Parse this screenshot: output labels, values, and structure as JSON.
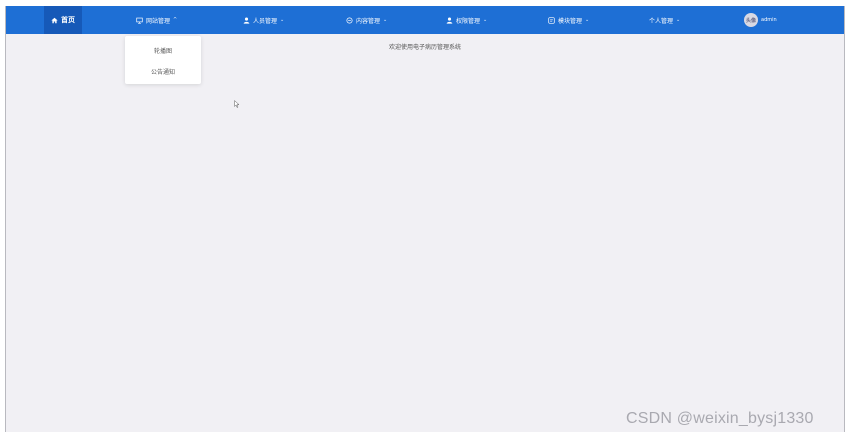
{
  "navbar": {
    "home": {
      "label": "首页",
      "icon": "home-icon"
    },
    "menus": [
      {
        "label": "网站管理",
        "icon": "monitor-icon",
        "chevron": "^",
        "expanded": true
      },
      {
        "label": "人员管理",
        "icon": "user-icon",
        "chevron": "⌄"
      },
      {
        "label": "内容管理",
        "icon": "content-icon",
        "chevron": "⌄"
      },
      {
        "label": "权限管理",
        "icon": "user-icon",
        "chevron": "⌄"
      },
      {
        "label": "模块管理",
        "icon": "module-icon",
        "chevron": "⌄"
      },
      {
        "label": "个人管理",
        "chevron": "⌄"
      }
    ],
    "user": {
      "avatar_text": "头像",
      "name": "admin"
    },
    "color": "#1e6fd5",
    "active_color": "#1659b8"
  },
  "dropdown": {
    "items": [
      "轮播图",
      "公告通知"
    ]
  },
  "main": {
    "welcome_text": "欢迎使用电子病历管理系统",
    "background": "#f1f0f4"
  },
  "watermark": "CSDN @weixin_bysj1330"
}
